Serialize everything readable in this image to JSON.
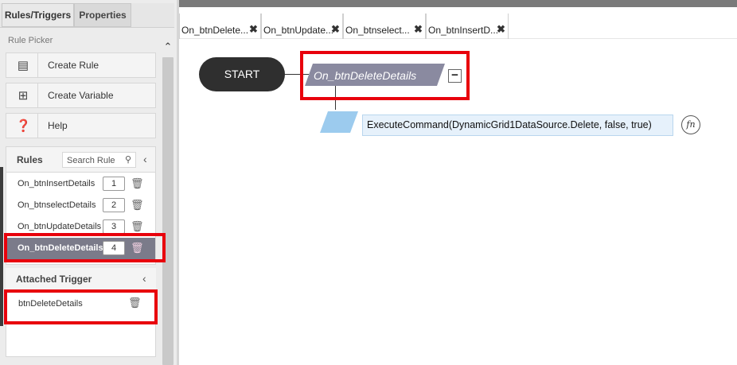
{
  "left_panel": {
    "tabs": [
      {
        "label": "Rules/Triggers"
      },
      {
        "label": "Properties"
      }
    ],
    "rule_picker": {
      "title": "Rule Picker",
      "items": [
        {
          "label": "Create Rule",
          "icon": "create-rule-icon"
        },
        {
          "label": "Create Variable",
          "icon": "create-variable-icon"
        },
        {
          "label": "Help",
          "icon": "help-icon"
        }
      ]
    },
    "rules": {
      "title": "Rules",
      "search_placeholder": "Search Rule",
      "items": [
        {
          "name": "On_btnInsertDetails",
          "count": "1"
        },
        {
          "name": "On_btnselectDetails",
          "count": "2"
        },
        {
          "name": "On_btnUpdateDetails",
          "count": "3"
        },
        {
          "name": "On_btnDeleteDetails",
          "count": "4",
          "selected": true
        }
      ]
    },
    "attached_trigger": {
      "title": "Attached Trigger",
      "items": [
        {
          "name": "btnDeleteDetails"
        }
      ]
    }
  },
  "editor": {
    "tabs": [
      {
        "label": "On_btnDelete..."
      },
      {
        "label": "On_btnUpdate..."
      },
      {
        "label": "On_btnselect..."
      },
      {
        "label": "On_btnInsertD..."
      }
    ],
    "canvas": {
      "start_label": "START",
      "trigger_label": "On_btnDeleteDetails",
      "collapse_symbol": "−",
      "action_text": "ExecuteCommand(DynamicGrid1DataSource.Delete, false, true)",
      "fn_label": "fn"
    }
  },
  "colors": {
    "highlight": "#e8000c",
    "trigger_shape": "#8a8aa0",
    "action_shape": "#9ccbee",
    "selected_rule_bg": "#7b7b8a",
    "start_bg": "#2f2f2f"
  }
}
